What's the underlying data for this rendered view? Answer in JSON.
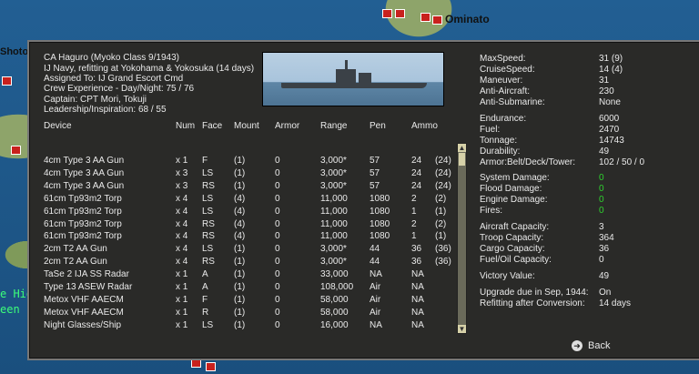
{
  "map": {
    "labels": {
      "ominato": "Ominato",
      "shoto": "Shoto",
      "hig": "e Hig",
      "een": "een"
    }
  },
  "ship": {
    "lines": [
      "CA Haguro (Myoko Class 9/1943)",
      "IJ Navy, refitting at Yokohama & Yokosuka (14 days)",
      "Assigned To:    IJ Grand Escort Cmd",
      "Crew Experience - Day/Night:  75  / 76",
      "Captain:  CPT Mori, Tokuji",
      "Leadership/Inspiration: 68 / 55"
    ]
  },
  "table": {
    "headers": [
      "Device",
      "Num",
      "Face",
      "Mount",
      "Armor",
      "Range",
      "Pen",
      "Ammo"
    ],
    "rows": [
      [
        "4cm Type 3 AA Gun",
        "x 1",
        "F",
        "(1)",
        "0",
        "3,000*",
        "57",
        "24",
        "(24)"
      ],
      [
        "4cm Type 3 AA Gun",
        "x 3",
        "LS",
        "(1)",
        "0",
        "3,000*",
        "57",
        "24",
        "(24)"
      ],
      [
        "4cm Type 3 AA Gun",
        "x 3",
        "RS",
        "(1)",
        "0",
        "3,000*",
        "57",
        "24",
        "(24)"
      ],
      [
        "61cm Tp93m2 Torp",
        "x 4",
        "LS",
        "(4)",
        "0",
        "11,000",
        "1080",
        "2",
        "(2)"
      ],
      [
        "61cm Tp93m2 Torp",
        "x 4",
        "LS",
        "(4)",
        "0",
        "11,000",
        "1080",
        "1",
        "(1)"
      ],
      [
        "61cm Tp93m2 Torp",
        "x 4",
        "RS",
        "(4)",
        "0",
        "11,000",
        "1080",
        "2",
        "(2)"
      ],
      [
        "61cm Tp93m2 Torp",
        "x 4",
        "RS",
        "(4)",
        "0",
        "11,000",
        "1080",
        "1",
        "(1)"
      ],
      [
        "2cm T2 AA Gun",
        "x 4",
        "LS",
        "(1)",
        "0",
        "3,000*",
        "44",
        "36",
        "(36)"
      ],
      [
        "2cm T2 AA Gun",
        "x 4",
        "RS",
        "(1)",
        "0",
        "3,000*",
        "44",
        "36",
        "(36)"
      ],
      [
        "TaSe 2 IJA SS Radar",
        "x 1",
        "A",
        "(1)",
        "0",
        "33,000",
        "NA",
        "NA",
        ""
      ],
      [
        "Type 13 ASEW Radar",
        "x 1",
        "A",
        "(1)",
        "0",
        "108,000",
        "Air",
        "NA",
        ""
      ],
      [
        "Metox VHF AAECM",
        "x 1",
        "F",
        "(1)",
        "0",
        "58,000",
        "Air",
        "NA",
        ""
      ],
      [
        "Metox VHF AAECM",
        "x 1",
        "R",
        "(1)",
        "0",
        "58,000",
        "Air",
        "NA",
        ""
      ],
      [
        "Night Glasses/Ship",
        "x 1",
        "LS",
        "(1)",
        "0",
        "16,000",
        "NA",
        "NA",
        ""
      ]
    ]
  },
  "stats": [
    [
      "MaxSpeed:",
      "31  (9)",
      ""
    ],
    [
      "CruiseSpeed:",
      "14  (4)",
      ""
    ],
    [
      "Maneuver:",
      "31",
      ""
    ],
    [
      "Anti-Aircraft:",
      "230",
      ""
    ],
    [
      "Anti-Submarine:",
      "None",
      ""
    ],
    [
      "Endurance:",
      "6000",
      ""
    ],
    [
      "Fuel:",
      "2470",
      ""
    ],
    [
      "Tonnage:",
      "14743",
      ""
    ],
    [
      "Durability:",
      "49",
      ""
    ],
    [
      "Armor:Belt/Deck/Tower:",
      "102 / 50 / 0",
      ""
    ],
    [
      "System Damage:",
      "0",
      "green"
    ],
    [
      "Flood Damage:",
      "0",
      "green"
    ],
    [
      "Engine Damage:",
      "0",
      "green"
    ],
    [
      "Fires:",
      "0",
      "green"
    ],
    [
      "Aircraft Capacity:",
      "3",
      ""
    ],
    [
      "Troop Capacity:",
      "364",
      ""
    ],
    [
      "Cargo Capacity:",
      "36",
      ""
    ],
    [
      "Fuel/Oil Capacity:",
      "0",
      ""
    ],
    [
      "Victory Value:",
      "49",
      ""
    ],
    [
      "Upgrade due in Sep, 1944:",
      "On",
      ""
    ],
    [
      "Refitting after Conversion:",
      "14 days",
      ""
    ]
  ],
  "back_label": "Back",
  "colors": {
    "panel": "#2a2a28",
    "damage_zero": "#2fd12f"
  }
}
